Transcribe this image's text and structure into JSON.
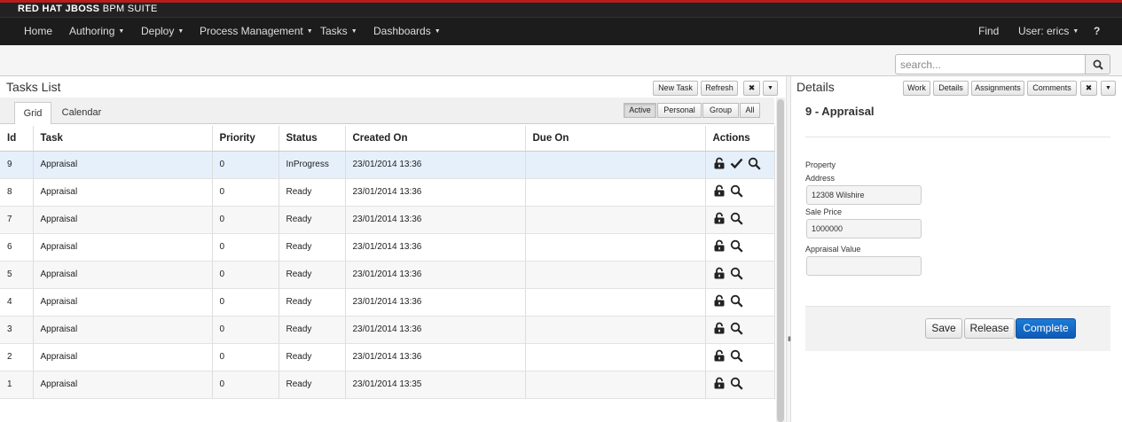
{
  "brand": {
    "strong": "RED HAT JBOSS",
    "light": "BPM SUITE"
  },
  "nav": {
    "home": "Home",
    "authoring": "Authoring",
    "deploy": "Deploy",
    "process_management": "Process Management",
    "tasks": "Tasks",
    "dashboards": "Dashboards",
    "find": "Find",
    "user": "User: erics",
    "help": "?"
  },
  "search": {
    "placeholder": "search..."
  },
  "tasks_panel": {
    "title": "Tasks List",
    "new_task": "New Task",
    "refresh": "Refresh",
    "close": "✖",
    "menu": "▼",
    "tabs": [
      "Grid",
      "Calendar"
    ],
    "filters": [
      "Active",
      "Personal",
      "Group",
      "All"
    ]
  },
  "columns": [
    "Id",
    "Task",
    "Priority",
    "Status",
    "Created On",
    "Due On",
    "Actions"
  ],
  "rows": [
    {
      "id": "9",
      "task": "Appraisal",
      "priority": "0",
      "status": "InProgress",
      "created": "23/01/2014 13:36",
      "due": ""
    },
    {
      "id": "8",
      "task": "Appraisal",
      "priority": "0",
      "status": "Ready",
      "created": "23/01/2014 13:36",
      "due": ""
    },
    {
      "id": "7",
      "task": "Appraisal",
      "priority": "0",
      "status": "Ready",
      "created": "23/01/2014 13:36",
      "due": ""
    },
    {
      "id": "6",
      "task": "Appraisal",
      "priority": "0",
      "status": "Ready",
      "created": "23/01/2014 13:36",
      "due": ""
    },
    {
      "id": "5",
      "task": "Appraisal",
      "priority": "0",
      "status": "Ready",
      "created": "23/01/2014 13:36",
      "due": ""
    },
    {
      "id": "4",
      "task": "Appraisal",
      "priority": "0",
      "status": "Ready",
      "created": "23/01/2014 13:36",
      "due": ""
    },
    {
      "id": "3",
      "task": "Appraisal",
      "priority": "0",
      "status": "Ready",
      "created": "23/01/2014 13:36",
      "due": ""
    },
    {
      "id": "2",
      "task": "Appraisal",
      "priority": "0",
      "status": "Ready",
      "created": "23/01/2014 13:36",
      "due": ""
    },
    {
      "id": "1",
      "task": "Appraisal",
      "priority": "0",
      "status": "Ready",
      "created": "23/01/2014 13:35",
      "due": ""
    }
  ],
  "details_panel": {
    "title": "Details",
    "tabs": [
      "Work",
      "Details",
      "Assignments",
      "Comments"
    ],
    "close": "✖",
    "menu": "▼",
    "heading": "9 - Appraisal",
    "property_label": "Property",
    "fields": [
      {
        "label": "Address",
        "value": "12308 Wilshire"
      },
      {
        "label": "Sale Price",
        "value": "1000000"
      },
      {
        "label": "Appraisal Value",
        "value": ""
      }
    ],
    "save": "Save",
    "release": "Release",
    "complete": "Complete"
  },
  "colors": {
    "brand_red": "#b91c1c",
    "nav_bg": "#1c1c1c",
    "primary": "#0d5bb5",
    "selected_row": "#e6f0fb"
  }
}
